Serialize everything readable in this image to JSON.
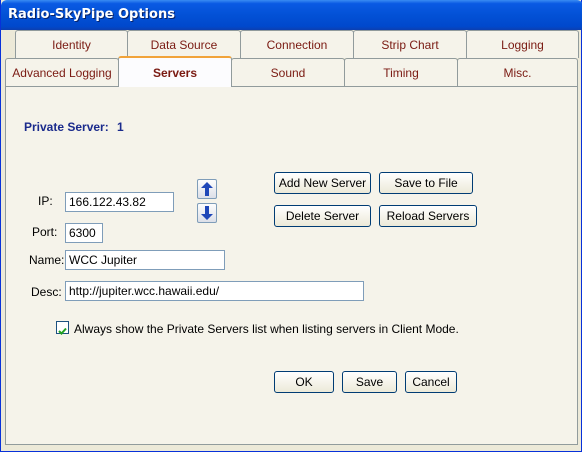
{
  "window": {
    "title": "Radio-SkyPipe Options"
  },
  "tabs_row1": [
    "Identity",
    "Data Source",
    "Connection",
    "Strip Chart",
    "Logging"
  ],
  "tabs_row2": [
    "Advanced Logging",
    "Servers",
    "Sound",
    "Timing",
    "Misc."
  ],
  "active_tab": "Servers",
  "servers": {
    "heading_label": "Private Server:",
    "server_number": "1",
    "ip_label": "IP:",
    "ip_value": "166.122.43.82",
    "port_label": "Port:",
    "port_value": "6300",
    "name_label": "Name:",
    "name_value": "WCC Jupiter",
    "desc_label": "Desc:",
    "desc_value": "http://jupiter.wcc.hawaii.edu/",
    "add_button": "Add New Server",
    "save_file_button": "Save to File",
    "delete_button": "Delete Server",
    "reload_button": "Reload Servers",
    "move_up_icon": "arrow-up-icon",
    "move_down_icon": "arrow-down-icon",
    "always_show_checked": true,
    "always_show_label": "Always show the Private Servers list when listing servers in Client Mode."
  },
  "footer": {
    "ok": "OK",
    "save": "Save",
    "cancel": "Cancel"
  },
  "colors": {
    "titlebar": "#0351d6",
    "tab_text": "#7a1a12",
    "heading": "#1a2a8c",
    "active_tab_accent": "#f1a33a"
  }
}
